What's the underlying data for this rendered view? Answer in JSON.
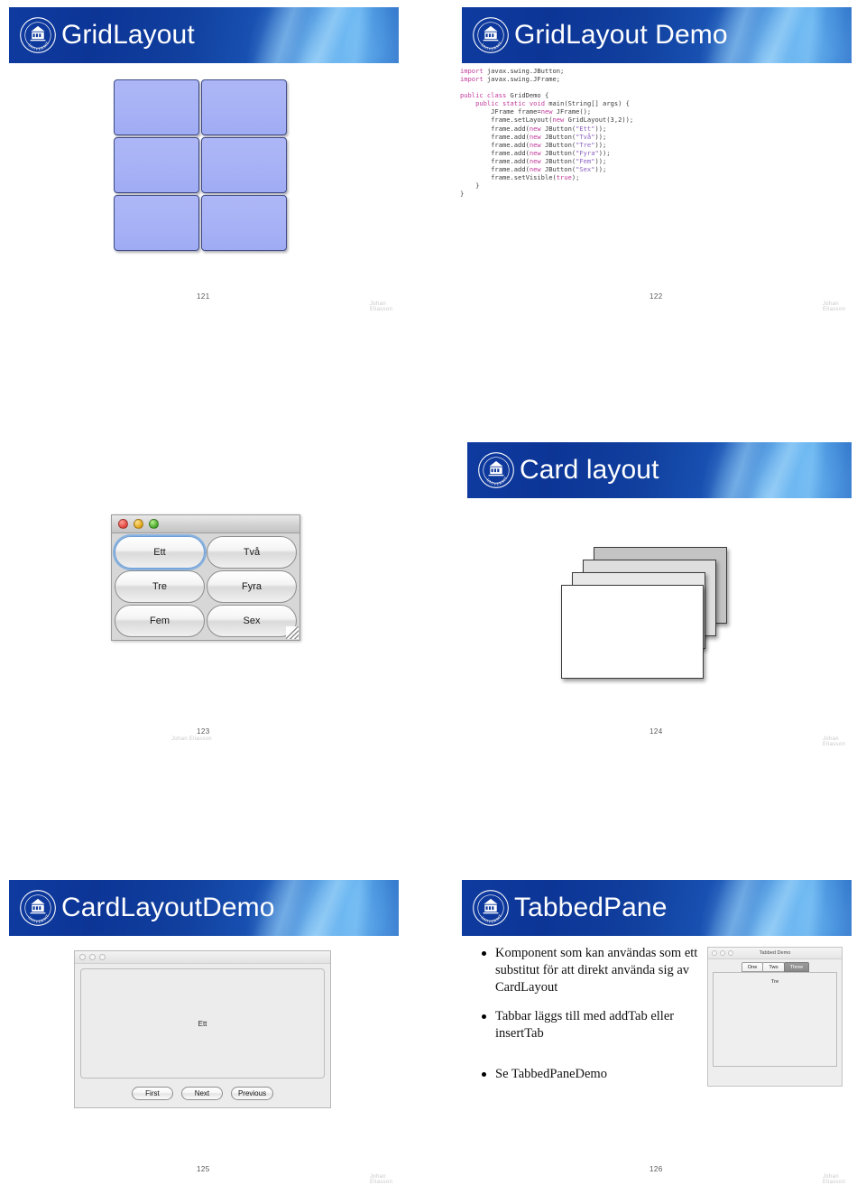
{
  "page": {
    "author_footer": "Johan Eliasson"
  },
  "slides": [
    {
      "id": "gridlayout",
      "title": "GridLayout",
      "number": "121",
      "author": "Johan Eliasson",
      "grid": {
        "rows": 3,
        "cols": 2,
        "cells": [
          "",
          "",
          "",
          "",
          "",
          ""
        ]
      }
    },
    {
      "id": "gridlayout-demo",
      "title": "GridLayout Demo",
      "number": "122",
      "author": "Johan Eliasson",
      "code_lines": [
        {
          "tokens": [
            {
              "t": "import",
              "c": "k"
            },
            {
              "t": " javax.swing.JButton;",
              "c": ""
            }
          ]
        },
        {
          "tokens": [
            {
              "t": "import",
              "c": "k"
            },
            {
              "t": " javax.swing.JFrame;",
              "c": ""
            }
          ]
        },
        {
          "tokens": [
            {
              "t": "",
              "c": ""
            }
          ]
        },
        {
          "tokens": [
            {
              "t": "public",
              "c": "k"
            },
            {
              "t": " ",
              "c": ""
            },
            {
              "t": "class",
              "c": "k"
            },
            {
              "t": " GridDemo {",
              "c": ""
            }
          ]
        },
        {
          "tokens": [
            {
              "t": "    ",
              "c": ""
            },
            {
              "t": "public",
              "c": "k"
            },
            {
              "t": " ",
              "c": ""
            },
            {
              "t": "static",
              "c": "k"
            },
            {
              "t": " ",
              "c": ""
            },
            {
              "t": "void",
              "c": "k"
            },
            {
              "t": " main(String[] args) {",
              "c": ""
            }
          ]
        },
        {
          "tokens": [
            {
              "t": "        JFrame frame=",
              "c": ""
            },
            {
              "t": "new",
              "c": "k"
            },
            {
              "t": " JFrame();",
              "c": ""
            }
          ]
        },
        {
          "tokens": [
            {
              "t": "        frame.setLayout(",
              "c": ""
            },
            {
              "t": "new",
              "c": "k"
            },
            {
              "t": " GridLayout(3,2));",
              "c": ""
            }
          ]
        },
        {
          "tokens": [
            {
              "t": "        frame.add(",
              "c": ""
            },
            {
              "t": "new",
              "c": "k"
            },
            {
              "t": " JButton(",
              "c": ""
            },
            {
              "t": "\"Ett\"",
              "c": "st"
            },
            {
              "t": "));",
              "c": ""
            }
          ]
        },
        {
          "tokens": [
            {
              "t": "        frame.add(",
              "c": ""
            },
            {
              "t": "new",
              "c": "k"
            },
            {
              "t": " JButton(",
              "c": ""
            },
            {
              "t": "\"Två\"",
              "c": "st"
            },
            {
              "t": "));",
              "c": ""
            }
          ]
        },
        {
          "tokens": [
            {
              "t": "        frame.add(",
              "c": ""
            },
            {
              "t": "new",
              "c": "k"
            },
            {
              "t": " JButton(",
              "c": ""
            },
            {
              "t": "\"Tre\"",
              "c": "st"
            },
            {
              "t": "));",
              "c": ""
            }
          ]
        },
        {
          "tokens": [
            {
              "t": "        frame.add(",
              "c": ""
            },
            {
              "t": "new",
              "c": "k"
            },
            {
              "t": " JButton(",
              "c": ""
            },
            {
              "t": "\"Fyra\"",
              "c": "st"
            },
            {
              "t": "));",
              "c": ""
            }
          ]
        },
        {
          "tokens": [
            {
              "t": "        frame.add(",
              "c": ""
            },
            {
              "t": "new",
              "c": "k"
            },
            {
              "t": " JButton(",
              "c": ""
            },
            {
              "t": "\"Fem\"",
              "c": "st"
            },
            {
              "t": "));",
              "c": ""
            }
          ]
        },
        {
          "tokens": [
            {
              "t": "        frame.add(",
              "c": ""
            },
            {
              "t": "new",
              "c": "k"
            },
            {
              "t": " JButton(",
              "c": ""
            },
            {
              "t": "\"Sex\"",
              "c": "st"
            },
            {
              "t": "));",
              "c": ""
            }
          ]
        },
        {
          "tokens": [
            {
              "t": "        frame.setVisible(",
              "c": ""
            },
            {
              "t": "true",
              "c": "k"
            },
            {
              "t": ");",
              "c": ""
            }
          ]
        },
        {
          "tokens": [
            {
              "t": "    }",
              "c": ""
            }
          ]
        },
        {
          "tokens": [
            {
              "t": "}",
              "c": ""
            }
          ]
        }
      ]
    },
    {
      "id": "grid-demo-window",
      "number": "123",
      "author": "Johan Eliasson",
      "window": {
        "buttons": [
          "Ett",
          "Två",
          "Tre",
          "Fyra",
          "Fem",
          "Sex"
        ],
        "focused_button": "Ett",
        "traffic_lights": [
          "close-red",
          "minimize-yellow",
          "zoom-green"
        ]
      }
    },
    {
      "id": "card-layout",
      "title": "Card layout",
      "number": "124",
      "author": "Johan Eliasson",
      "card_count": 4
    },
    {
      "id": "cardlayout-demo",
      "title": "CardLayoutDemo",
      "number": "125",
      "author": "Johan Eliasson",
      "window": {
        "card_label": "Ett",
        "buttons": [
          "First",
          "Next",
          "Previous"
        ]
      }
    },
    {
      "id": "tabbedpane",
      "title": "TabbedPane",
      "number": "126",
      "author": "Johan Eliasson",
      "bullets": [
        "Komponent som kan användas som ett substitut för att direkt använda sig av CardLayout",
        "Tabbar läggs till med addTab eller insertTab",
        "Se TabbedPaneDemo"
      ],
      "window": {
        "title": "Tabbed Demo",
        "tabs": [
          "One",
          "Two",
          "Three"
        ],
        "active_tab": "Three",
        "content": "Tre"
      }
    }
  ],
  "colors": {
    "banner_blue": "#0f3ba0",
    "banner_light": "#2d7fd4",
    "grid_button": "#a7b2f6",
    "grid_button_border": "#3e4a85",
    "code_keyword": "#c0399a",
    "code_string": "#8a5fc0",
    "code_text": "#3b3b3b"
  }
}
